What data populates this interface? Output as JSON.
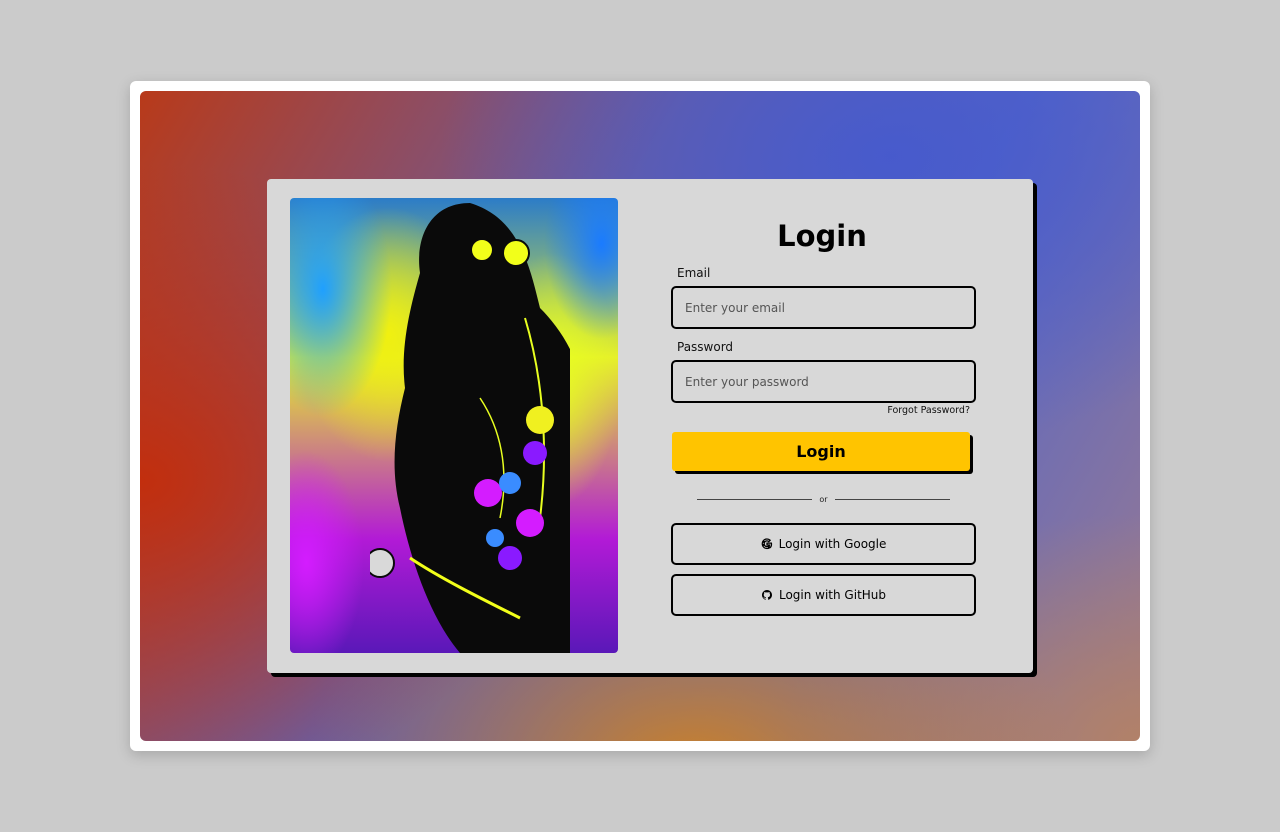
{
  "login": {
    "title": "Login",
    "email_label": "Email",
    "email_placeholder": "Enter your email",
    "password_label": "Password",
    "password_placeholder": "Enter your password",
    "forgot_password": "Forgot Password?",
    "login_button": "Login",
    "divider_text": "or",
    "google_button": "Login with Google",
    "github_button": "Login with GitHub"
  },
  "icons": {
    "google": "google-icon",
    "github": "github-icon"
  },
  "colors": {
    "accent": "#ffc400",
    "card_background": "#d8d8d8",
    "border": "#000000"
  }
}
